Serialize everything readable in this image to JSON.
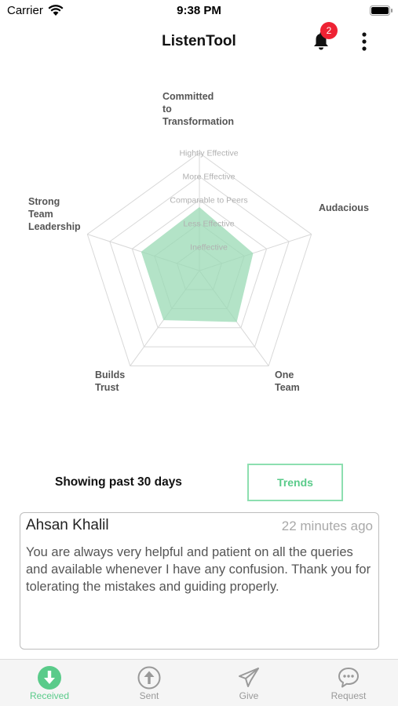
{
  "status": {
    "carrier": "Carrier",
    "time": "9:38 PM"
  },
  "header": {
    "title": "ListenTool",
    "notification_count": "2"
  },
  "chart_data": {
    "type": "radar",
    "axes": [
      "Committed to Transformation",
      "Audacious",
      "One Team",
      "Builds Trust",
      "Strong Team Leadership"
    ],
    "axis_label_lines": [
      [
        "Committed",
        "to",
        "Transformation"
      ],
      [
        "Audacious"
      ],
      [
        "One",
        "Team"
      ],
      [
        "Builds",
        "Trust"
      ],
      [
        "Strong",
        "Team",
        "Leadership"
      ]
    ],
    "levels": [
      "Ineffective",
      "Less Effective",
      "Comparable to Peers",
      "More Effective",
      "Hightly Effective"
    ],
    "values": [
      2.7,
      2.4,
      2.7,
      2.6,
      2.6
    ],
    "range": [
      0,
      5
    ],
    "fill_color": "#9ad9b4",
    "grid_color": "#d8d8d8"
  },
  "filter": {
    "showing_label": "Showing past 30 days",
    "trends_label": "Trends"
  },
  "feedback": {
    "name": "Ahsan Khalil",
    "time": "22 minutes ago",
    "message": "You are always very helpful and patient on all the queries and available whenever I have any confusion. Thank you for tolerating the mistakes and guiding properly."
  },
  "tabs": [
    {
      "label": "Received",
      "icon": "arrow-down-circle-icon",
      "active": true
    },
    {
      "label": "Sent",
      "icon": "arrow-up-circle-icon",
      "active": false
    },
    {
      "label": "Give",
      "icon": "paper-plane-icon",
      "active": false
    },
    {
      "label": "Request",
      "icon": "chat-bubble-icon",
      "active": false
    }
  ],
  "colors": {
    "accent": "#5acb8a",
    "badge": "#ee2233"
  }
}
